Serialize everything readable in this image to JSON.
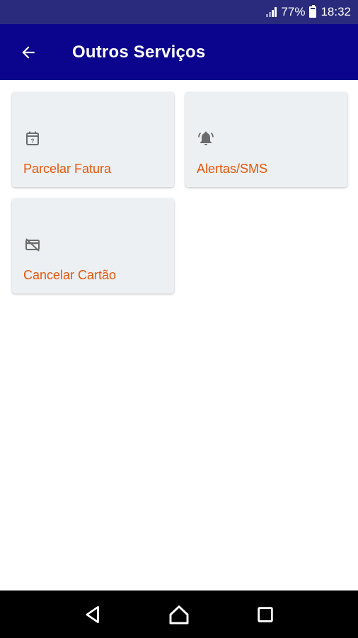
{
  "status": {
    "battery": "77%",
    "time": "18:32"
  },
  "app_bar": {
    "title": "Outros Serviços",
    "back_icon": "arrow-back-icon"
  },
  "services": [
    {
      "label": "Parcelar Fatura",
      "icon": "calendar-question-icon"
    },
    {
      "label": "Alertas/SMS",
      "icon": "bell-ringing-icon"
    },
    {
      "label": "Cancelar Cartão",
      "icon": "credit-card-off-icon"
    }
  ],
  "colors": {
    "status_bar": "#2b2b7e",
    "app_bar": "#0b048c",
    "card_background": "#edf0f2",
    "label_accent": "#e8560b",
    "icon": "#6b6b6b"
  },
  "navigation": {
    "back": "nav-back-icon",
    "home": "nav-home-icon",
    "recents": "nav-recents-icon"
  }
}
